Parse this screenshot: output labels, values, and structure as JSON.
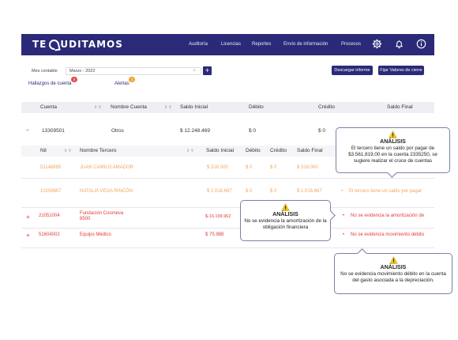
{
  "header": {
    "logo_left": "TE",
    "logo_right": "UDITAMOS",
    "nav": [
      "Auditoría",
      "Licencias",
      "Reportes",
      "Envío de información",
      "Procesos"
    ],
    "icons": [
      "gear-icon",
      "bell-icon",
      "info-icon"
    ]
  },
  "filters": {
    "month_label": "Mes contable",
    "month_value": "Marzo - 2022",
    "download_label": "Descargar informe",
    "fix_label": "Fijar Valores de cierre"
  },
  "tabs": {
    "findings_label": "Hallazgos de cuenta",
    "findings_count": "3",
    "alerts_label": "Alertas",
    "alerts_count": "1"
  },
  "main_table": {
    "columns": [
      "Cuenta",
      "Nombre Cuenta",
      "Saldo Inicial",
      "Débito",
      "Crédito",
      "Saldo Final"
    ],
    "row": {
      "toggle": "−",
      "account": "13309501",
      "name": "Otros",
      "initial": "$ 12.248.469",
      "debit": "$ 0",
      "credit": "$ 0"
    }
  },
  "sub_table": {
    "columns": [
      "Nit",
      "Nombre Tercero",
      "Saldo Inicial",
      "Débito",
      "Crédito",
      "Saldo Final"
    ],
    "rows": [
      {
        "nit": "51148885",
        "name": "JUAN CAMILO AMADOR",
        "initial": "$ 318.000",
        "debit": "$ 0",
        "credit": "$ 0",
        "final": "$ 318.000",
        "note": ""
      },
      {
        "nit": "10258667",
        "name": "NATALIA VEGA RINCÓN",
        "initial": "$ 1.016.667",
        "debit": "$ 0",
        "credit": "$ 0",
        "final": "$ 1.016.667",
        "note": "El tercero tiene un saldo por pagar"
      }
    ]
  },
  "red_rows": [
    {
      "toggle": "+",
      "account": "21051004",
      "name_line1": "Fundación Coomeva",
      "name_line2": "8500",
      "initial": "$-16.199.962",
      "note": "No se evidencia la amortización de"
    },
    {
      "toggle": "+",
      "account": "51604002",
      "name_line1": "Equipo Médico",
      "name_line2": "",
      "initial": "$ 75.988",
      "note": "No se evidencia movimiento débito"
    }
  ],
  "callouts": [
    {
      "title": "ANÁLISIS",
      "text": "El tercero tiene un saldo por pagar de $3.561.819,00 en la cuenta 2335250, se sugiere realizar el cruce de cuentas"
    },
    {
      "title": "ANÁLISIS",
      "text": "No se evidencia la amortización de la obligación financiera"
    },
    {
      "title": "ANÁLISIS",
      "text": "No se evidencia movimiento débito en la cuenta del gasto asociada a la depreciación."
    }
  ],
  "colors": {
    "brand": "#2b2a78",
    "warning_text": "#f2a660",
    "error_text": "#e23b3b",
    "badge_red": "#e84b4b",
    "badge_orange": "#f2a33a"
  }
}
